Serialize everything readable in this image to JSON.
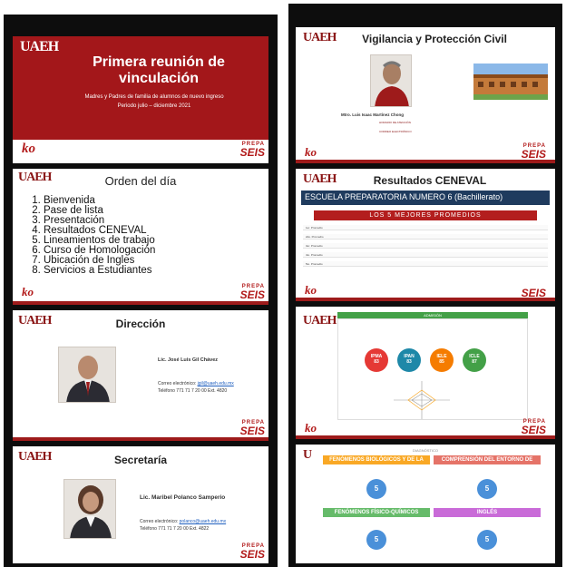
{
  "brand": {
    "uaeh": "UAEH",
    "prepa_top": "PREPA",
    "prepa_bottom": "SEIS",
    "logo_bottom": "ko"
  },
  "slide1": {
    "title": "Primera reunión de vinculación",
    "subtitle": "Madres y Padres de familia de alumnos de nuevo ingreso",
    "period": "Periodo julio – diciembre 2021"
  },
  "slide2": {
    "title": "Orden del día",
    "items": [
      "Bienvenida",
      "Pase de lista",
      "Presentación",
      "Resultados CENEVAL",
      "Lineamientos de trabajo",
      "Curso de Homologación",
      "Ubicación de Ingles",
      "Servicios a Estudiantes"
    ]
  },
  "slide3": {
    "title": "Dirección",
    "name": "Lic. José Luis Gil Chávez",
    "email_label": "Correo electrónico:",
    "email": "jgil@uaeh.edu.mx",
    "phone": "Teléfono 771 71 7 20 00 Ext. 4820"
  },
  "slide4": {
    "title": "Secretaría",
    "name": "Lic. Maribel Polanco Samperio",
    "email_label": "Correo electrónico:",
    "email": "polanco@uaeh.edu.mx",
    "phone": "Teléfono 771 71 7 20 00 Ext. 4822"
  },
  "slide5": {
    "title": "Vigilancia y Protección Civil",
    "name": "Mtro. Luis Isaac Martínez Chong",
    "l1": "HORARIO DE ATENCIÓN",
    "l2": "CORREO ELECTRÓNICO"
  },
  "slide6": {
    "title": "Resultados CENEVAL",
    "school": "ESCUELA PREPARATORIA NUMERO 6 (Bachillerato)",
    "section": "LOS 5 MEJORES PROMEDIOS",
    "rows": [
      "1er. Promedio",
      "2do. Promedio",
      "3er. Promedio",
      "4to. Promedio",
      "5to. Promedio"
    ]
  },
  "slide7": {
    "header": "ADMISIÓN",
    "circles": [
      {
        "label": "IPMA",
        "value": "83",
        "color": "#e53935"
      },
      {
        "label": "IPAN",
        "value": "83",
        "color": "#1e88a8"
      },
      {
        "label": "IELE",
        "value": "85",
        "color": "#f57c00"
      },
      {
        "label": "ICLE",
        "value": "87",
        "color": "#43a047"
      }
    ]
  },
  "slide8": {
    "header": "DIAGNÓSTICO",
    "cats": [
      {
        "label": "FENÓMENOS BIOLÓGICOS Y DE LA SALUD",
        "value": "5",
        "color": "#f9a825"
      },
      {
        "label": "COMPRENSIÓN DEL ENTORNO DE MÉXICO",
        "value": "5",
        "color": "#e57368"
      },
      {
        "label": "FENÓMENOS FÍSICO-QUÍMICOS",
        "value": "5",
        "color": "#66bb6a"
      },
      {
        "label": "INGLÉS",
        "value": "5",
        "color": "#c96bd8"
      }
    ]
  }
}
